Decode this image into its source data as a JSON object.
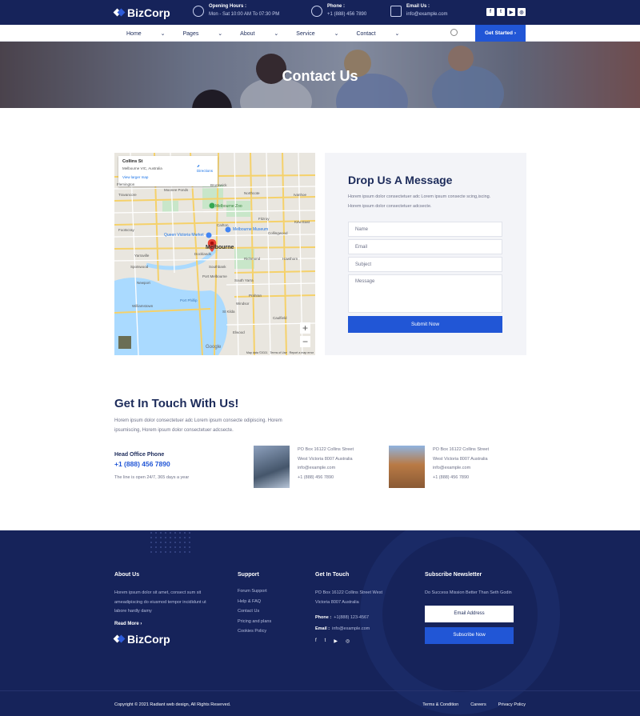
{
  "brand": {
    "name": "BizCorp"
  },
  "topbar": {
    "hours_label": "Opening Hours :",
    "hours_value": "Mon - Sat 10:00 AM To 07:30 PM",
    "phone_label": "Phone :",
    "phone_value": "+1 (888) 456 7890",
    "email_label": "Email Us :",
    "email_value": "info@example.com",
    "socials": [
      "f",
      "t",
      "▶",
      "◎"
    ]
  },
  "nav": {
    "items": [
      "Home",
      "Pages",
      "About",
      "Service",
      "Contact"
    ],
    "cta": "Get Started ›"
  },
  "hero": {
    "title": "Contact Us"
  },
  "map": {
    "place": "Collins St",
    "address": "Melbourne VIC, Australia",
    "view_larger": "View larger map",
    "directions": "Directions",
    "city": "Melbourne",
    "zoom_in": "+",
    "zoom_out": "−",
    "google": "Google",
    "footer_text": "Map data ©2021   Terms of Use   Report a map error",
    "labels": [
      "Flemington",
      "Travancore",
      "Moonee Ponds",
      "Brunswick",
      "Northcote",
      "Fitzroy",
      "Carlton",
      "Collingwood",
      "Richmond",
      "Footscray",
      "Yarraville",
      "Spotswood",
      "Newport",
      "Williamstown",
      "Port Melbourne",
      "South Yarra",
      "St Kilda",
      "Prahran",
      "Windsor",
      "Caulfield",
      "Elwood",
      "Hawthorn",
      "Kew East",
      "Ivanhoe",
      "Melbourne Zoo",
      "Melbourne Museum",
      "Queen Victoria Market",
      "Docklands",
      "Southbank",
      "Port Phillip"
    ]
  },
  "form": {
    "title": "Drop Us A Message",
    "desc": "Horem ipsum dolor consectetuer adc Lorem ipsum consecte scing,iscing. Horem ipsum dolor consectetuer adcsecte.",
    "name_ph": "Name",
    "email_ph": "Email",
    "subject_ph": "Subject",
    "message_ph": "Message",
    "submit": "Submit Now"
  },
  "touch": {
    "title": "Get In Touch With Us!",
    "desc": "Horem ipsum dolor consectetuer adc Lorem ipsum consecte odipiscing. Horem ipsumiscing, Horem ipsum dolor consectetuer adcsecte.",
    "office_label": "Head Office Phone",
    "office_phone": "+1 (888) 456 7890",
    "open": "The line is open 24/7, 365 days a year",
    "offices": [
      {
        "line1": "PO Box 16122 Collins Street",
        "line2": "West Victoria 8007 Australia",
        "email": "info@example.com",
        "phone": "+1 (888) 456 7890"
      },
      {
        "line1": "PO Box 16122 Collins Street",
        "line2": "West Victoria 8007 Australia",
        "email": "info@example.com",
        "phone": "+1 (888) 456 7890"
      }
    ]
  },
  "footer": {
    "about_title": "About Us",
    "about_text": "Horem ipsum dolor sit amet, consect sum sit ameadipiscing do eiusmod tempor incididunt ut labore hardly damy",
    "read_more": "Read More ›",
    "support_title": "Support",
    "support_links": [
      "Forum Support",
      "Help & FAQ",
      "Contact Us",
      "Pricing and plans",
      "Cookies Policy"
    ],
    "touch_title": "Get In Touch",
    "touch_addr": "PO Box 16122 Collins Street West Victoria 8007 Australia",
    "phone_label": "Phone :",
    "phone_value": "+1(888) 123-4567",
    "email_label": "Email :",
    "email_value": "info@example.com",
    "socials": [
      "f",
      "t",
      "▶",
      "◎"
    ],
    "newsletter_title": "Subscribe Newsletter",
    "newsletter_text": "Do Success Mission Better Than Seth Godin",
    "email_btn": "Email Address",
    "subscribe_btn": "Subscribe Now",
    "copyright": "Copyright © 2021 Radiant web design, All Rights Reserved.",
    "bottom_links": [
      "Terms & Condition",
      "Careers",
      "Privacy Policy"
    ]
  },
  "colors": {
    "navy": "#16235a",
    "blue": "#2156d6"
  }
}
